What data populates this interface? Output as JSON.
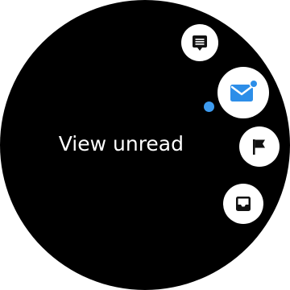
{
  "screen": {
    "option_label": "View unread"
  },
  "menu": {
    "items": [
      {
        "icon": "message-list-icon"
      },
      {
        "icon": "unread-mail-icon",
        "selected": true
      },
      {
        "icon": "flag-icon"
      },
      {
        "icon": "inbox-icon"
      }
    ]
  },
  "colors": {
    "background": "#000000",
    "button": "#ffffff",
    "accent": "#3d9bf0",
    "icon": "#111111"
  }
}
